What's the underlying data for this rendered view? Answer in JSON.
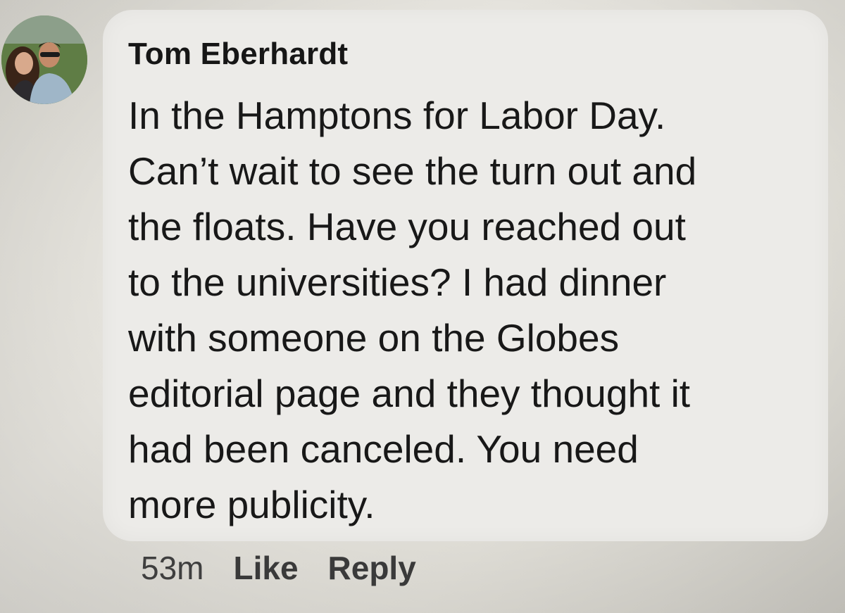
{
  "comment": {
    "author": "Tom Eberhardt",
    "text": "In the Hamptons for Labor Day.\nCan’t wait to see the turn out and\nthe floats. Have you reached out\nto the universities?  I had dinner\nwith someone on the Globes\neditorial page and they thought it\nhad been canceled. You need\nmore publicity.",
    "timestamp": "53m",
    "like_label": "Like",
    "reply_label": "Reply"
  },
  "colors": {
    "bubble": "#ecebe8",
    "text": "#181818",
    "meta": "#3a3a3a"
  }
}
